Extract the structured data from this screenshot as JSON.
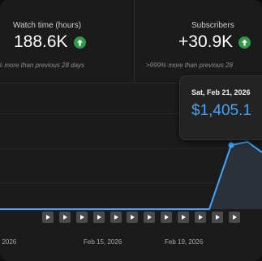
{
  "metrics": {
    "watch_time": {
      "label": "Watch time (hours)",
      "value": "188.6K",
      "compare": "% more than previous 28 days"
    },
    "subscribers": {
      "label": "Subscribers",
      "value": "+30.9K",
      "compare": ">999% more than previous 28"
    }
  },
  "chart": {
    "x_ticks": [
      ", 2026",
      "Feb 15, 2026",
      "Feb 19, 2026"
    ],
    "marker_count": 12,
    "line_color": "#3ea6ff"
  },
  "tooltip": {
    "date": "Sat, Feb 21, 2026",
    "value": "$1,405.1"
  }
}
